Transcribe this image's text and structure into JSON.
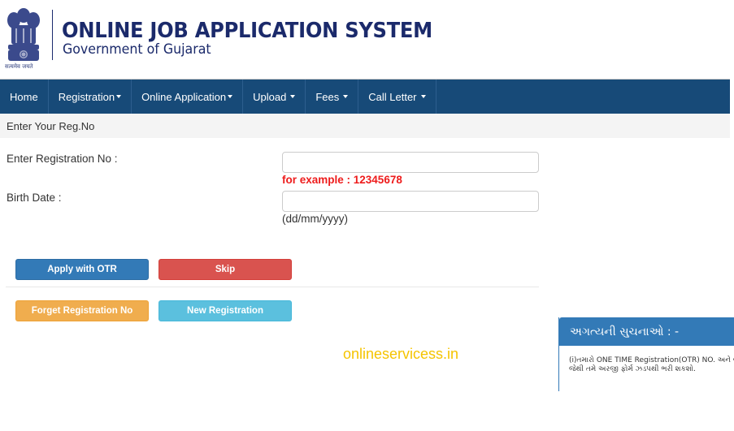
{
  "header": {
    "emblem_motto": "सत्यमेव जयते",
    "title": "ONLINE JOB APPLICATION SYSTEM",
    "subtitle": "Government of Gujarat"
  },
  "nav": {
    "items": [
      {
        "label": "Home",
        "has_dropdown": false
      },
      {
        "label": "Registration",
        "has_dropdown": true
      },
      {
        "label": "Online Application",
        "has_dropdown": true
      },
      {
        "label": "Upload",
        "has_dropdown": true
      },
      {
        "label": "Fees",
        "has_dropdown": true
      },
      {
        "label": "Call Letter",
        "has_dropdown": true
      }
    ]
  },
  "section": {
    "title": "Enter Your Reg.No"
  },
  "form": {
    "reg_label": "Enter Registration No :",
    "reg_value": "",
    "reg_hint": "for example : 12345678",
    "dob_label": "Birth Date :",
    "dob_value": "",
    "dob_hint": "(dd/mm/yyyy)"
  },
  "buttons": {
    "apply_otr": "Apply with OTR",
    "skip": "Skip",
    "forget_reg": "Forget Registration No",
    "new_reg": "New Registration"
  },
  "watermark": "onlineservicess.in",
  "notice": {
    "title": "અગત્યની સુચનાઓ : -",
    "line1": "(i)તમારો ONE TIME Registration(OTR) NO. અને જન્મ",
    "line2": "જેથી તમે અરજી ફોર્મ ઝડપથી ભરી શકશો."
  },
  "colors": {
    "nav_bg": "#174a78",
    "title_navy": "#1b2a6b",
    "primary": "#337ab7",
    "danger": "#d9534f",
    "warning": "#f0ad4e",
    "info": "#5bc0de",
    "hint_red": "#ee1c1c",
    "watermark": "#f5c400"
  }
}
